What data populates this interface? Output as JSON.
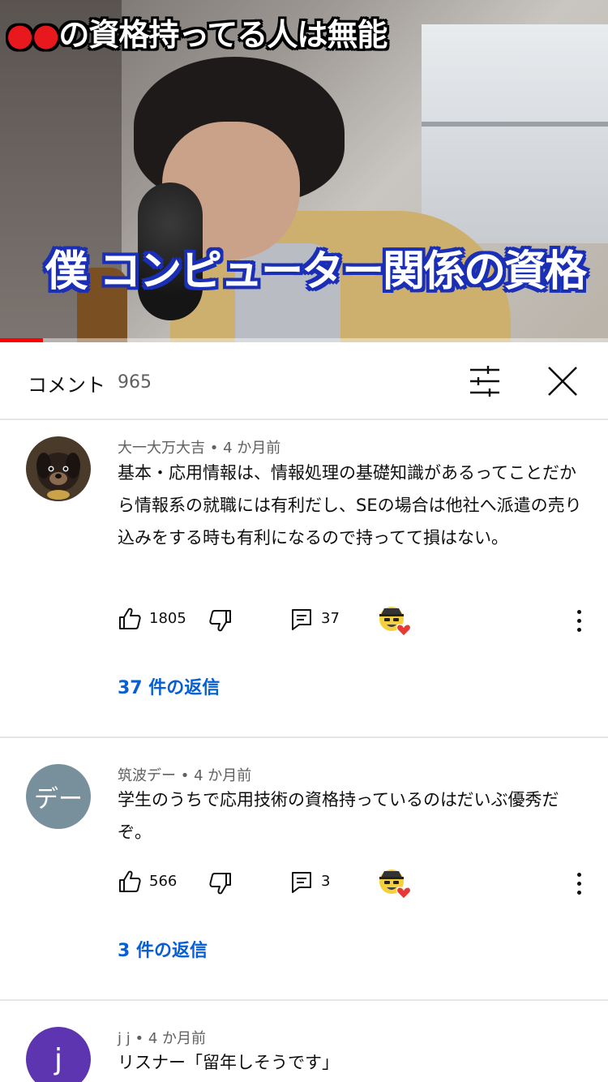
{
  "video": {
    "overlay_top_prefix": "●●",
    "overlay_top_rest": "の資格持ってる人は無能",
    "overlay_caption": "僕 コンピューター関係の資格",
    "progress_fraction": 0.07,
    "colors": {
      "progress": "#ff0000",
      "caption_outline": "#1a2fb5",
      "top_dots": "#e8191e"
    }
  },
  "comments_panel": {
    "title": "コメント",
    "count": "965",
    "sort_icon": "sliders-icon",
    "close_icon": "close-icon"
  },
  "comments": [
    {
      "author": "大一大万大吉",
      "time": "4 か月前",
      "avatar_color": "#5c4632",
      "text": "基本・応用情報は、情報処理の基礎知識があるってことだから情報系の就職には有利だし、SEの場合は他社へ派遣の売り込みをする時も有利になるので持ってて損はない。",
      "likes": "1805",
      "reply_count": "37",
      "replies_label": "37 件の返信"
    },
    {
      "author": "筑波デー",
      "time": "4 か月前",
      "avatar_text": "デー",
      "avatar_color": "#78909c",
      "text": "学生のうちで応用技術の資格持っているのはだいぶ優秀だぞ。",
      "likes": "566",
      "reply_count": "3",
      "replies_label": "3 件の返信"
    },
    {
      "author": "j j",
      "time": "4 か月前",
      "avatar_text": "j",
      "avatar_color": "#5e35b1",
      "text": "リスナー「留年しそうです」"
    }
  ],
  "meta_separator": "•",
  "accent_link_color": "#065fd4"
}
